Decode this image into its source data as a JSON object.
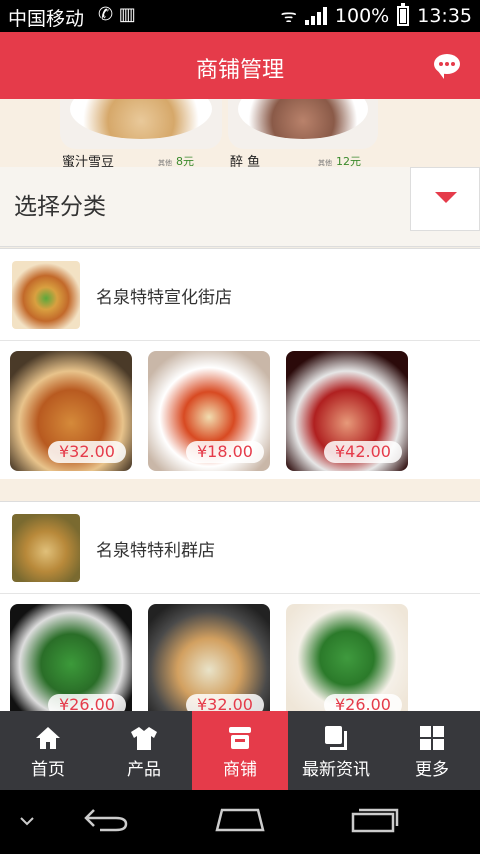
{
  "status_bar": {
    "carrier": "中国移动",
    "battery": "100%",
    "time": "13:35"
  },
  "header": {
    "title": "商铺管理",
    "right_icon": "chat-bubble-icon"
  },
  "banner": {
    "items": [
      {
        "name": "蜜汁雪豆",
        "price": "8元"
      },
      {
        "name": "醉 鱼",
        "price": "12元"
      }
    ]
  },
  "category": {
    "label": "选择分类",
    "dropdown_icon": "dropdown-triangle-icon"
  },
  "stores": [
    {
      "name": "名泉特特宣化街店",
      "products": [
        {
          "price": "¥32.00"
        },
        {
          "price": "¥18.00"
        },
        {
          "price": "¥42.00"
        }
      ]
    },
    {
      "name": "名泉特特利群店",
      "products": [
        {
          "price": "¥26.00"
        },
        {
          "price": "¥32.00"
        },
        {
          "price": "¥26.00"
        }
      ]
    }
  ],
  "bottom_nav": {
    "items": [
      {
        "label": "首页",
        "icon": "home-icon"
      },
      {
        "label": "产品",
        "icon": "shirt-icon"
      },
      {
        "label": "商铺",
        "icon": "shop-icon",
        "active": true
      },
      {
        "label": "最新资讯",
        "icon": "news-icon"
      },
      {
        "label": "更多",
        "icon": "grid-icon"
      }
    ]
  },
  "colors": {
    "accent": "#e53b4a",
    "nav_bg": "#37383c"
  }
}
